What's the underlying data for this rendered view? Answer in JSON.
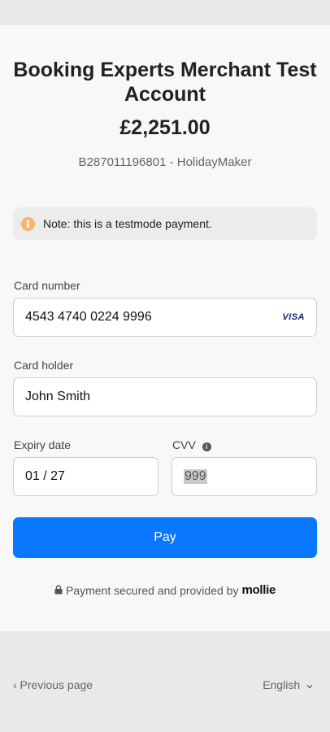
{
  "merchant": {
    "name_line1": "Booking Experts Merchant Test",
    "name_line2": "Account",
    "amount": "£2,251.00",
    "reference": "B287011196801 - HolidayMaker"
  },
  "notice": {
    "text": "Note: this is a testmode payment.",
    "icon": "info-icon",
    "color": "#f6b66b"
  },
  "form": {
    "card_number_label": "Card number",
    "card_number_value": "4543 4740 0224 9996",
    "card_brand": "VISA",
    "card_holder_label": "Card holder",
    "card_holder_value": "John Smith",
    "expiry_label": "Expiry date",
    "expiry_value": "01 / 27",
    "cvv_label": "CVV",
    "cvv_value": "999"
  },
  "pay_button": {
    "label": "Pay",
    "color": "#0a77ff"
  },
  "security": {
    "text": "Payment secured and provided by",
    "brand": "mollie",
    "icon": "lock-icon"
  },
  "footer": {
    "previous": "‹ Previous page",
    "language": "English"
  }
}
